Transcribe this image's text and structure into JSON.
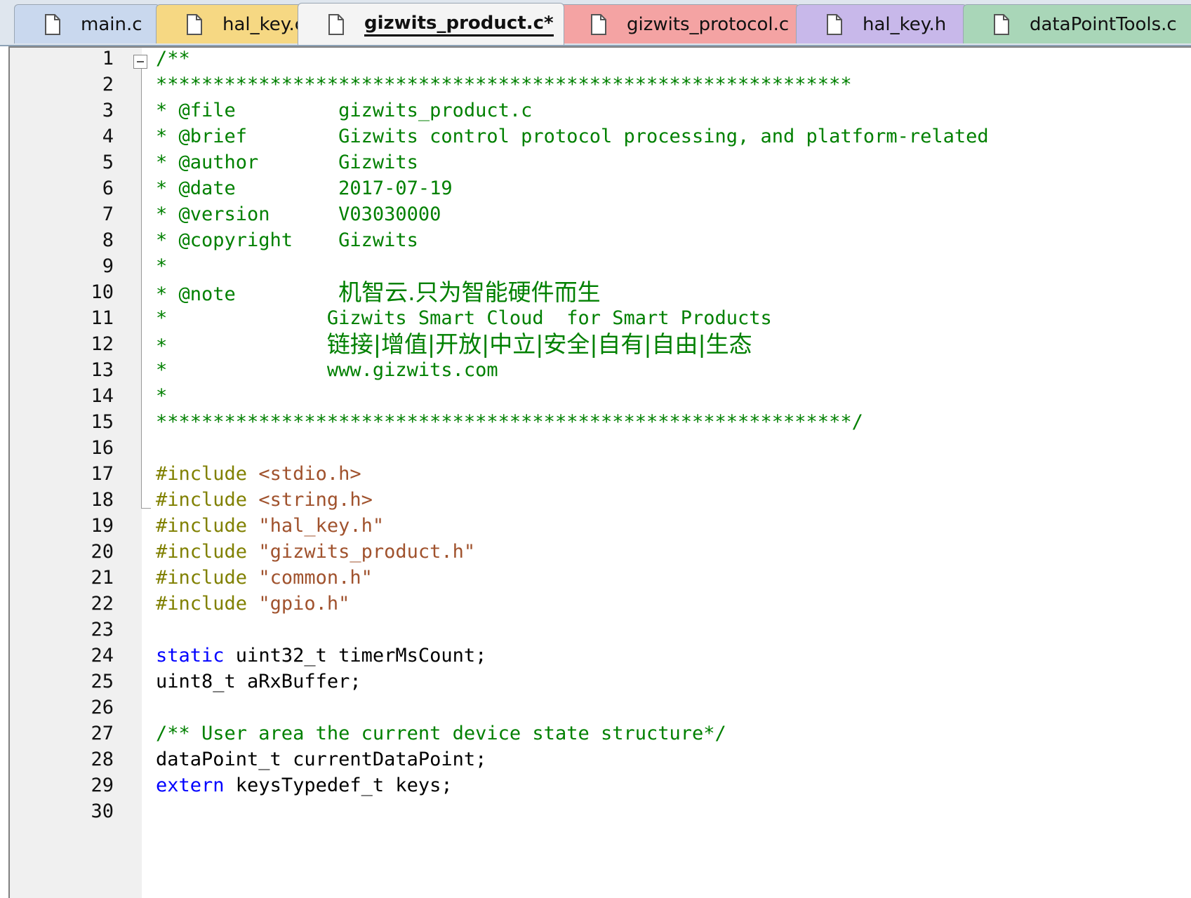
{
  "tabs": [
    {
      "label": "main.c",
      "color": "#c9d8ee",
      "active": false
    },
    {
      "label": "hal_key.c",
      "color": "#f6d883",
      "active": false
    },
    {
      "label": "gizwits_product.c*",
      "color": "#f4f4f4",
      "active": true
    },
    {
      "label": "gizwits_protocol.c",
      "color": "#f4a3a3",
      "active": false
    },
    {
      "label": "hal_key.h",
      "color": "#c8b8ea",
      "active": false
    },
    {
      "label": "dataPointTools.c",
      "color": "#a9d6b8",
      "active": false
    }
  ],
  "code_lines": [
    {
      "n": "1",
      "parts": [
        [
          "comment",
          "/**"
        ]
      ]
    },
    {
      "n": "2",
      "parts": [
        [
          "comment",
          "*************************************************************"
        ]
      ]
    },
    {
      "n": "3",
      "parts": [
        [
          "comment",
          "* @file         gizwits_product.c"
        ]
      ]
    },
    {
      "n": "4",
      "parts": [
        [
          "comment",
          "* @brief        Gizwits control protocol processing, and platform-related"
        ]
      ]
    },
    {
      "n": "5",
      "parts": [
        [
          "comment",
          "* @author       Gizwits"
        ]
      ]
    },
    {
      "n": "6",
      "parts": [
        [
          "comment",
          "* @date         2017-07-19"
        ]
      ]
    },
    {
      "n": "7",
      "parts": [
        [
          "comment",
          "* @version      V03030000"
        ]
      ]
    },
    {
      "n": "8",
      "parts": [
        [
          "comment",
          "* @copyright    Gizwits"
        ]
      ]
    },
    {
      "n": "9",
      "parts": [
        [
          "comment",
          "*"
        ]
      ]
    },
    {
      "n": "10",
      "parts": [
        [
          "comment",
          "* @note         "
        ],
        [
          "cjk",
          "机智云.只为智能硬件而生"
        ]
      ]
    },
    {
      "n": "11",
      "parts": [
        [
          "comment",
          "*              Gizwits Smart Cloud  for Smart Products"
        ]
      ]
    },
    {
      "n": "12",
      "parts": [
        [
          "comment",
          "*              "
        ],
        [
          "cjk",
          "链接|增值|开放|中立|安全|自有|自由|生态"
        ]
      ]
    },
    {
      "n": "13",
      "parts": [
        [
          "comment",
          "*              www.gizwits.com"
        ]
      ]
    },
    {
      "n": "14",
      "parts": [
        [
          "comment",
          "*"
        ]
      ]
    },
    {
      "n": "15",
      "parts": [
        [
          "comment",
          "*************************************************************/"
        ]
      ]
    },
    {
      "n": "16",
      "parts": []
    },
    {
      "n": "17",
      "parts": [
        [
          "pre",
          "#include "
        ],
        [
          "str",
          "<stdio.h>"
        ]
      ]
    },
    {
      "n": "18",
      "parts": [
        [
          "pre",
          "#include "
        ],
        [
          "str",
          "<string.h>"
        ]
      ]
    },
    {
      "n": "19",
      "parts": [
        [
          "pre",
          "#include "
        ],
        [
          "str",
          "\"hal_key.h\""
        ]
      ]
    },
    {
      "n": "20",
      "parts": [
        [
          "pre",
          "#include "
        ],
        [
          "str",
          "\"gizwits_product.h\""
        ]
      ]
    },
    {
      "n": "21",
      "parts": [
        [
          "pre",
          "#include "
        ],
        [
          "str",
          "\"common.h\""
        ]
      ]
    },
    {
      "n": "22",
      "parts": [
        [
          "pre",
          "#include "
        ],
        [
          "str",
          "\"gpio.h\""
        ]
      ]
    },
    {
      "n": "23",
      "parts": []
    },
    {
      "n": "24",
      "parts": [
        [
          "kw",
          "static"
        ],
        [
          "plain",
          " uint32_t timerMsCount;"
        ]
      ]
    },
    {
      "n": "25",
      "parts": [
        [
          "plain",
          "uint8_t aRxBuffer;"
        ]
      ]
    },
    {
      "n": "26",
      "parts": []
    },
    {
      "n": "27",
      "parts": [
        [
          "comment",
          "/** User area the current device state structure*/"
        ]
      ]
    },
    {
      "n": "28",
      "parts": [
        [
          "plain",
          "dataPoint_t currentDataPoint;"
        ]
      ]
    },
    {
      "n": "29",
      "parts": [
        [
          "kw",
          "extern"
        ],
        [
          "plain",
          " keysTypedef_t keys;"
        ]
      ]
    },
    {
      "n": "30",
      "parts": []
    }
  ]
}
